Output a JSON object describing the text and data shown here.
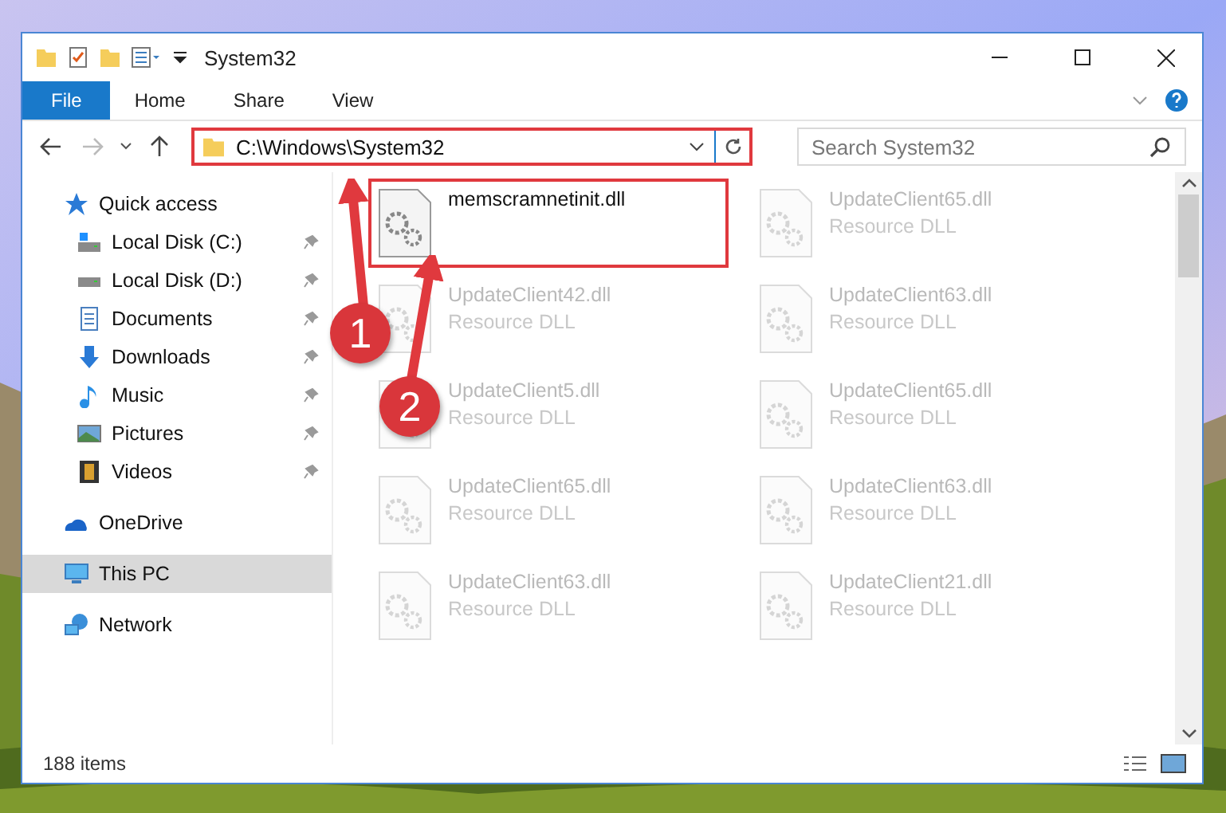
{
  "window": {
    "title": "System32"
  },
  "ribbon_tabs": [
    {
      "label": "File",
      "kind": "file"
    },
    {
      "label": "Home",
      "kind": "tab"
    },
    {
      "label": "Share",
      "kind": "tab"
    },
    {
      "label": "View",
      "kind": "tab"
    }
  ],
  "address": {
    "path": "C:\\Windows\\System32",
    "highlighted": true
  },
  "search": {
    "placeholder": "Search System32"
  },
  "nav": [
    {
      "label": "Quick access",
      "selected": false,
      "children": [
        {
          "label": "Local Disk (C:)",
          "pinned": true,
          "selected": false
        },
        {
          "label": "Local Disk (D:)",
          "pinned": true,
          "selected": false
        },
        {
          "label": "Documents",
          "pinned": true,
          "selected": false
        },
        {
          "label": "Downloads",
          "pinned": true,
          "selected": false
        },
        {
          "label": "Music",
          "pinned": true,
          "selected": false
        },
        {
          "label": "Pictures",
          "pinned": true,
          "selected": false
        },
        {
          "label": "Videos",
          "pinned": true,
          "selected": false
        }
      ]
    },
    {
      "label": "OneDrive",
      "selected": false
    },
    {
      "label": "This PC",
      "selected": true
    },
    {
      "label": "Network",
      "selected": false
    }
  ],
  "files": [
    {
      "name": "memscramnetinit.dll",
      "highlighted": true,
      "blurred": false
    },
    {
      "name": "UpdateClient65.dll",
      "type": "Resource DLL",
      "highlighted": false,
      "blurred": true
    },
    {
      "name": "UpdateClient42.dll",
      "type": "Resource DLL",
      "highlighted": false,
      "blurred": true
    },
    {
      "name": "UpdateClient63.dll",
      "type": "Resource DLL",
      "highlighted": false,
      "blurred": true
    },
    {
      "name": "UpdateClient5.dll",
      "type": "Resource DLL",
      "highlighted": false,
      "blurred": true
    },
    {
      "name": "UpdateClient65.dll",
      "type": "Resource DLL",
      "highlighted": false,
      "blurred": true
    },
    {
      "name": "UpdateClient65.dll",
      "type": "Resource DLL",
      "highlighted": false,
      "blurred": true
    },
    {
      "name": "UpdateClient63.dll",
      "type": "Resource DLL",
      "highlighted": false,
      "blurred": true
    },
    {
      "name": "UpdateClient63.dll",
      "type": "Resource DLL",
      "highlighted": false,
      "blurred": true
    },
    {
      "name": "UpdateClient21.dll",
      "type": "Resource DLL",
      "highlighted": false,
      "blurred": true
    }
  ],
  "callouts": [
    {
      "number": "1"
    },
    {
      "number": "2"
    }
  ],
  "status_bar": {
    "count": "188 items"
  }
}
